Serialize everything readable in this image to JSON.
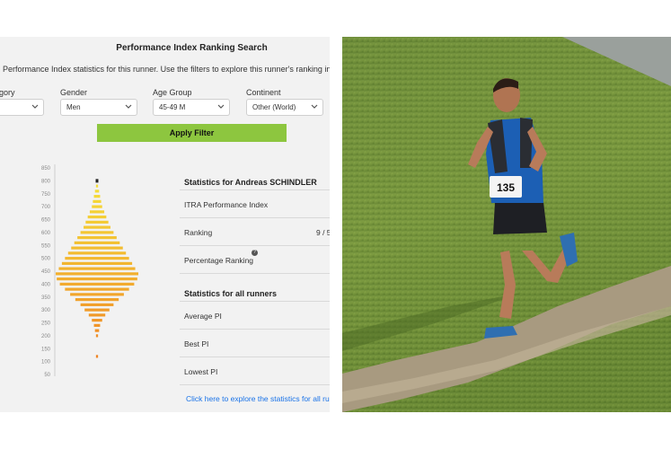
{
  "page_title": "Performance Index Ranking Search",
  "subtitle": "Performance Index statistics for this runner. Use the filters to explore this runner's ranking in diffe",
  "filters": [
    {
      "label": "gory",
      "value": ""
    },
    {
      "label": "Gender",
      "value": "Men"
    },
    {
      "label": "Age Group",
      "value": "45-49 M"
    },
    {
      "label": "Continent",
      "value": "Other (World)"
    }
  ],
  "apply_label": "Apply Filter",
  "chart_data": {
    "type": "bar",
    "orientation": "horizontal-symmetric",
    "y_ticks": [
      "850",
      "800",
      "750",
      "700",
      "650",
      "600",
      "550",
      "500",
      "450",
      "400",
      "350",
      "300",
      "250",
      "200",
      "150",
      "100",
      "50"
    ],
    "ylim": [
      50,
      850
    ],
    "runner_marker_pi": 800,
    "bins": [
      {
        "pi": 800,
        "count": 1
      },
      {
        "pi": 780,
        "count": 1
      },
      {
        "pi": 760,
        "count": 2
      },
      {
        "pi": 740,
        "count": 3
      },
      {
        "pi": 720,
        "count": 4
      },
      {
        "pi": 700,
        "count": 5
      },
      {
        "pi": 680,
        "count": 7
      },
      {
        "pi": 660,
        "count": 9
      },
      {
        "pi": 640,
        "count": 11
      },
      {
        "pi": 620,
        "count": 13
      },
      {
        "pi": 600,
        "count": 16
      },
      {
        "pi": 580,
        "count": 19
      },
      {
        "pi": 560,
        "count": 22
      },
      {
        "pi": 540,
        "count": 25
      },
      {
        "pi": 520,
        "count": 28
      },
      {
        "pi": 500,
        "count": 31
      },
      {
        "pi": 480,
        "count": 34
      },
      {
        "pi": 460,
        "count": 37
      },
      {
        "pi": 440,
        "count": 40
      },
      {
        "pi": 420,
        "count": 39
      },
      {
        "pi": 400,
        "count": 36
      },
      {
        "pi": 380,
        "count": 31
      },
      {
        "pi": 360,
        "count": 26
      },
      {
        "pi": 340,
        "count": 21
      },
      {
        "pi": 320,
        "count": 16
      },
      {
        "pi": 300,
        "count": 12
      },
      {
        "pi": 280,
        "count": 8
      },
      {
        "pi": 260,
        "count": 5
      },
      {
        "pi": 240,
        "count": 3
      },
      {
        "pi": 220,
        "count": 2
      },
      {
        "pi": 200,
        "count": 1
      },
      {
        "pi": 120,
        "count": 1
      }
    ]
  },
  "stats_runner": {
    "heading": "Statistics for Andreas SCHINDLER",
    "rows": [
      {
        "label": "ITRA Performance Index",
        "value": ""
      },
      {
        "label": "Ranking",
        "value": "9 / 5"
      },
      {
        "label": "Percentage Ranking",
        "value": ""
      }
    ]
  },
  "stats_all": {
    "heading": "Statistics for all runners",
    "rows": [
      {
        "label": "Average PI"
      },
      {
        "label": "Best PI"
      },
      {
        "label": "Lowest PI"
      }
    ]
  },
  "link_text": "Click here to explore the statistics for all ru",
  "bib_number": "135",
  "colors": {
    "apply_button": "#8dc63f",
    "link": "#1a73e8",
    "bar_top": "#f6e83a",
    "bar_bottom": "#ee7a22"
  }
}
